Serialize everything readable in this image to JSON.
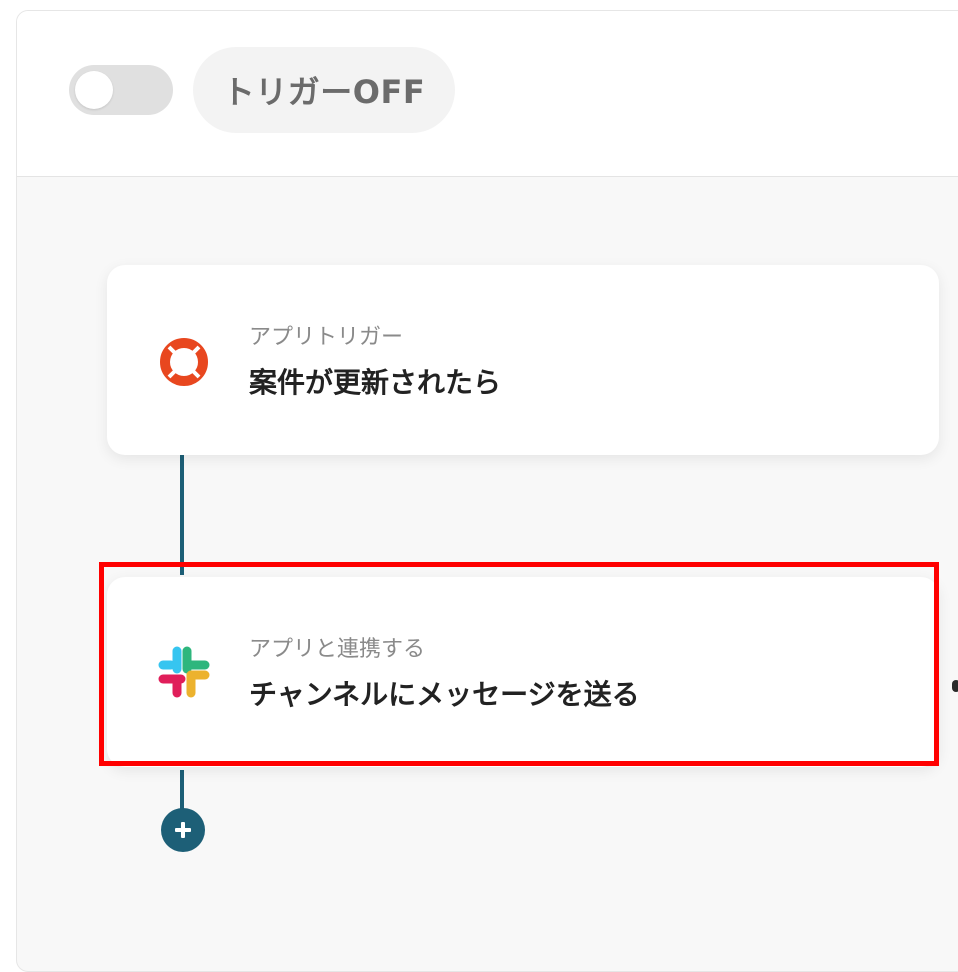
{
  "header": {
    "trigger_status_label": "トリガーOFF",
    "toggle_state": "off"
  },
  "flow": {
    "steps": [
      {
        "subtitle": "アプリトリガー",
        "title": "案件が更新されたら",
        "icon": "lifebuoy-ring-icon",
        "color": "#e8471f"
      },
      {
        "subtitle": "アプリと連携する",
        "title": "チャンネルにメッセージを送る",
        "icon": "slack-icon",
        "highlighted": true
      }
    ],
    "connector_color": "#1d5f77",
    "add_button_icon": "plus-icon"
  },
  "highlight_color": "#ff0000"
}
